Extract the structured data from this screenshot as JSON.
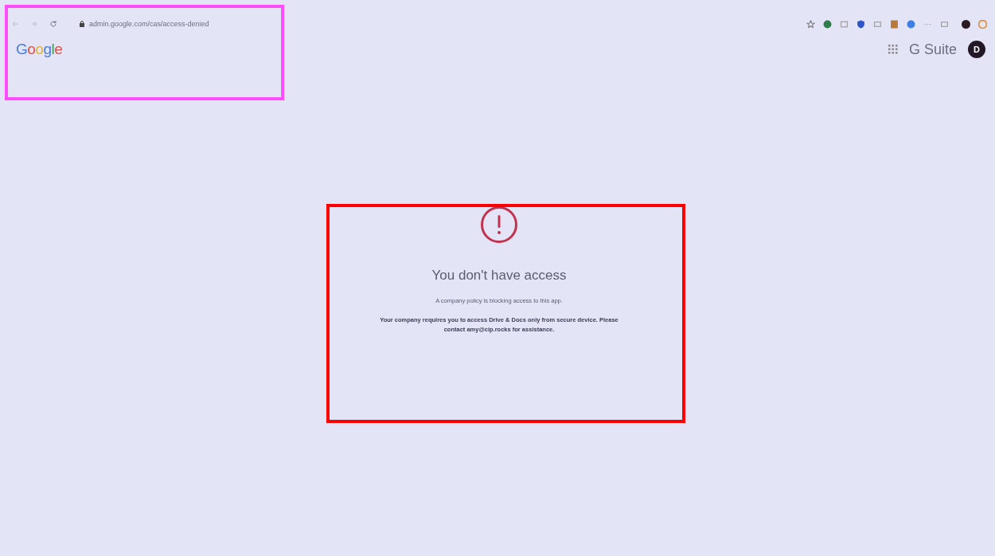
{
  "browser": {
    "url": "admin.google.com/cas/access-denied"
  },
  "header": {
    "logo": "Google",
    "product": "G Suite",
    "avatar": "D"
  },
  "message": {
    "title": "You don't have access",
    "subtitle": "A company policy is blocking access to this app.",
    "detail": "Your company requires you to access Drive & Docs only from secure device. Please contact amy@cip.rocks for assistance."
  },
  "annotations": [
    {
      "color": "#ff4dff"
    },
    {
      "color": "#ff0000"
    }
  ]
}
